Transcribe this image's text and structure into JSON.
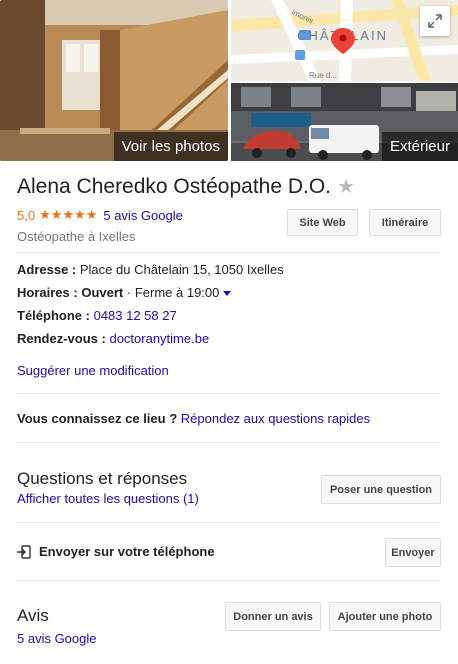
{
  "photos": {
    "main_label": "Voir les photos",
    "exterior_label": "Extérieur"
  },
  "map": {
    "district_label": "CHÂTELAIN",
    "street_label_1": "Rue d...",
    "street_label_2": "imonis"
  },
  "place": {
    "name": "Alena Cheredko Ostéopathe D.O.",
    "rating": "5,0",
    "stars_filled": 5,
    "reviews_link": "5 avis Google",
    "category": "Ostéopathe à Ixelles"
  },
  "actions": {
    "website": "Site Web",
    "directions": "Itinéraire"
  },
  "details": {
    "address_label": "Adresse :",
    "address_value": "Place du Châtelain 15, 1050 Ixelles",
    "hours_label": "Horaires :",
    "hours_open": "Ouvert",
    "hours_sep": "·",
    "hours_close": "Ferme à 19:00",
    "phone_label": "Téléphone :",
    "phone_value": "0483 12 58 27",
    "booking_label": "Rendez-vous :",
    "booking_value": "doctoranytime.be"
  },
  "suggest_edit": "Suggérer une modification",
  "know_place": {
    "question": "Vous connaissez ce lieu ?",
    "link": "Répondez aux questions rapides"
  },
  "qa": {
    "title": "Questions et réponses",
    "link": "Afficher toutes les questions (1)",
    "button": "Poser une question"
  },
  "send": {
    "label": "Envoyer sur votre téléphone",
    "button": "Envoyer"
  },
  "reviews": {
    "title": "Avis",
    "link": "5 avis Google",
    "write_button": "Donner un avis",
    "photo_button": "Ajouter une photo"
  },
  "colors": {
    "link": "#1a0dab",
    "star": "#e7711b",
    "map_pin": "#ea4335"
  }
}
